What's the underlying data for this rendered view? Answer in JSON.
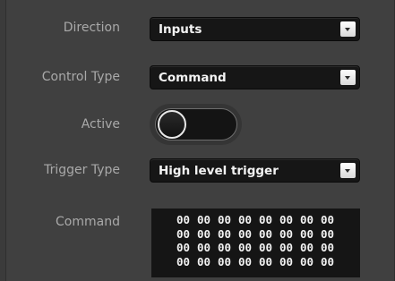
{
  "form": {
    "direction": {
      "label": "Direction",
      "value": "Inputs"
    },
    "control_type": {
      "label": "Control Type",
      "value": "Command"
    },
    "active": {
      "label": "Active",
      "on": false
    },
    "trigger_type": {
      "label": "Trigger Type",
      "value": "High level trigger"
    },
    "command": {
      "label": "Command",
      "bytes": [
        [
          "00",
          "00",
          "00",
          "00",
          "00",
          "00",
          "00",
          "00"
        ],
        [
          "00",
          "00",
          "00",
          "00",
          "00",
          "00",
          "00",
          "00"
        ],
        [
          "00",
          "00",
          "00",
          "00",
          "00",
          "00",
          "00",
          "00"
        ],
        [
          "00",
          "00",
          "00",
          "00",
          "00",
          "00",
          "00",
          "00"
        ]
      ]
    }
  },
  "icons": {
    "dropdown": "chevron-down-icon"
  },
  "colors": {
    "background": "#404040",
    "label": "#a9a9a9",
    "field": "#161616",
    "text": "#f2f2f2"
  }
}
